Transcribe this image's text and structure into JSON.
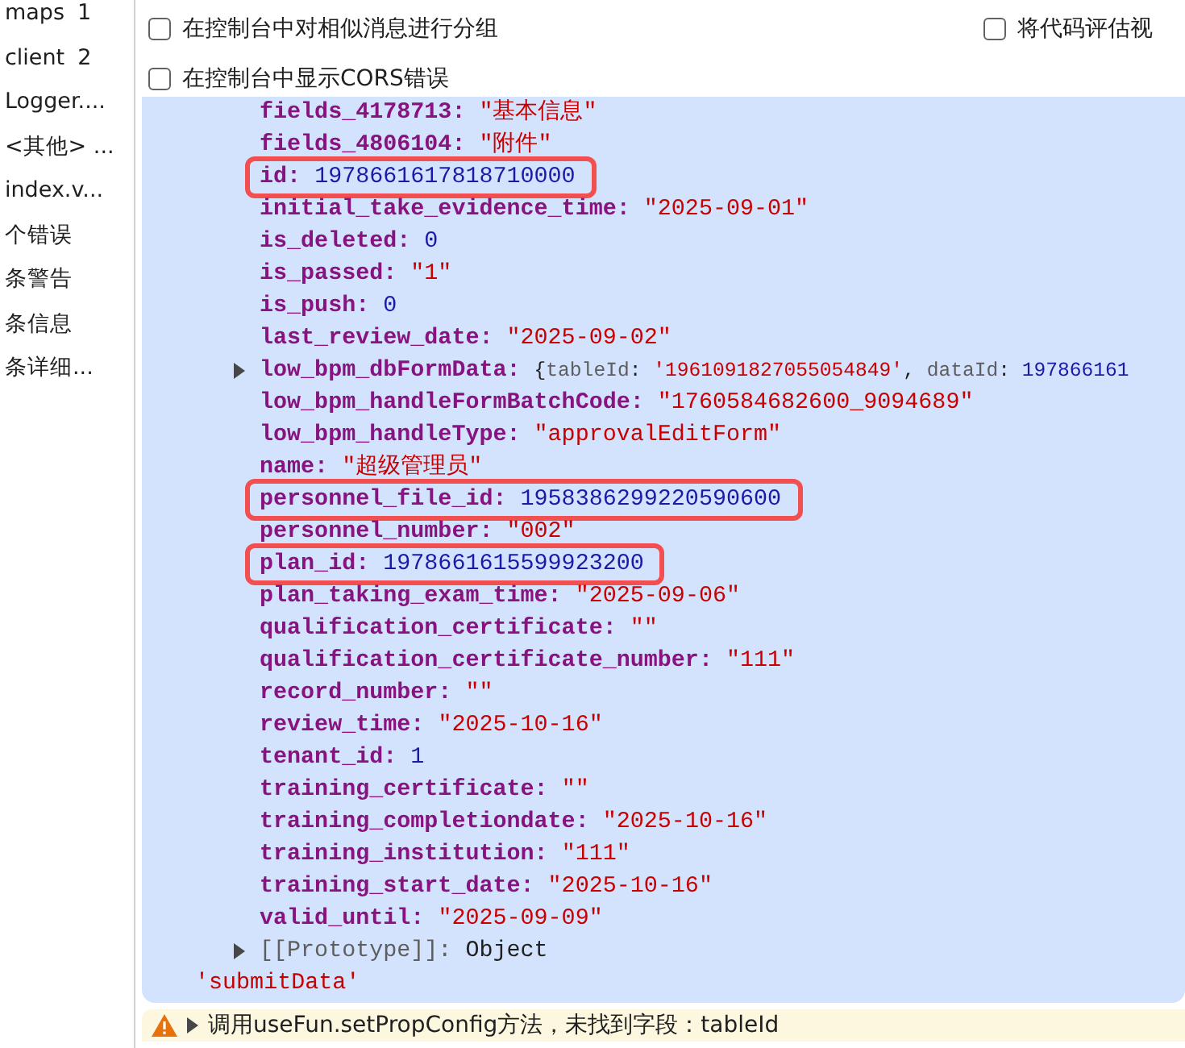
{
  "sidebar": {
    "items": [
      {
        "label": "maps",
        "count": "1"
      },
      {
        "label": "client",
        "count": "2"
      },
      {
        "label": "Logger...."
      },
      {
        "label": "<其他> ..."
      },
      {
        "label": "index.v..."
      },
      {
        "label": "个错误"
      },
      {
        "label": "条警告"
      },
      {
        "label": "条信息"
      },
      {
        "label": "条详细..."
      }
    ]
  },
  "settings": [
    {
      "label": "在控制台中对相似消息进行分组",
      "checked": false
    },
    {
      "label": "将代码评估视",
      "checked": false
    },
    {
      "label": "在控制台中显示CORS错误",
      "checked": false
    }
  ],
  "console": {
    "properties": [
      {
        "key": "fields_4178713:",
        "kind": "string",
        "value": "\"基本信息\"",
        "highlighted": false
      },
      {
        "key": "fields_4806104:",
        "kind": "string",
        "value": "\"附件\"",
        "highlighted": false
      },
      {
        "key": "id:",
        "kind": "number",
        "value": "1978661617818710000",
        "highlighted": true
      },
      {
        "key": "initial_take_evidence_time:",
        "kind": "string",
        "value": "\"2025-09-01\"",
        "highlighted": false
      },
      {
        "key": "is_deleted:",
        "kind": "number",
        "value": "0",
        "highlighted": false
      },
      {
        "key": "is_passed:",
        "kind": "string",
        "value": "\"1\"",
        "highlighted": false
      },
      {
        "key": "is_push:",
        "kind": "number",
        "value": "0",
        "highlighted": false
      },
      {
        "key": "last_review_date:",
        "kind": "string",
        "value": "\"2025-09-02\"",
        "highlighted": false
      },
      {
        "key": "low_bpm_dbFormData:",
        "kind": "object",
        "expanded": false,
        "preview": [
          {
            "kind": "punct",
            "text": "{"
          },
          {
            "kind": "subkey",
            "text": "tableId"
          },
          {
            "kind": "punct",
            "text": ": "
          },
          {
            "kind": "string",
            "text": "'1961091827055054849'"
          },
          {
            "kind": "punct",
            "text": ", "
          },
          {
            "kind": "subkey",
            "text": "dataId"
          },
          {
            "kind": "punct",
            "text": ": "
          },
          {
            "kind": "number",
            "text": "197866161"
          }
        ],
        "highlighted": false
      },
      {
        "key": "low_bpm_handleFormBatchCode:",
        "kind": "string",
        "value": "\"1760584682600_9094689\"",
        "highlighted": false
      },
      {
        "key": "low_bpm_handleType:",
        "kind": "string",
        "value": "\"approvalEditForm\"",
        "highlighted": false
      },
      {
        "key": "name:",
        "kind": "string",
        "value": "\"超级管理员\"",
        "highlighted": false
      },
      {
        "key": "personnel_file_id:",
        "kind": "number",
        "value": "1958386299220590600",
        "highlighted": true
      },
      {
        "key": "personnel_number:",
        "kind": "string",
        "value": "\"002\"",
        "highlighted": false
      },
      {
        "key": "plan_id:",
        "kind": "number",
        "value": "1978661615599923200",
        "highlighted": true
      },
      {
        "key": "plan_taking_exam_time:",
        "kind": "string",
        "value": "\"2025-09-06\"",
        "highlighted": false
      },
      {
        "key": "qualification_certificate:",
        "kind": "string",
        "value": "\"\"",
        "highlighted": false
      },
      {
        "key": "qualification_certificate_number:",
        "kind": "string",
        "value": "\"111\"",
        "highlighted": false
      },
      {
        "key": "record_number:",
        "kind": "string",
        "value": "\"\"",
        "highlighted": false
      },
      {
        "key": "review_time:",
        "kind": "string",
        "value": "\"2025-10-16\"",
        "highlighted": false
      },
      {
        "key": "tenant_id:",
        "kind": "number",
        "value": "1",
        "highlighted": false
      },
      {
        "key": "training_certificate:",
        "kind": "string",
        "value": "\"\"",
        "highlighted": false
      },
      {
        "key": "training_completiondate:",
        "kind": "string",
        "value": "\"2025-10-16\"",
        "highlighted": false
      },
      {
        "key": "training_institution:",
        "kind": "string",
        "value": "\"111\"",
        "highlighted": false
      },
      {
        "key": "training_start_date:",
        "kind": "string",
        "value": "\"2025-10-16\"",
        "highlighted": false
      },
      {
        "key": "valid_until:",
        "kind": "string",
        "value": "\"2025-09-09\"",
        "highlighted": false
      },
      {
        "key": "[[Prototype]]:",
        "kind": "prototype",
        "value": "Object",
        "expanded": false,
        "highlighted": false
      }
    ],
    "label": "'submitData'"
  },
  "warning": {
    "expanded": false,
    "text": "调用useFun.setPropConfig方法，未找到字段：tableId"
  }
}
